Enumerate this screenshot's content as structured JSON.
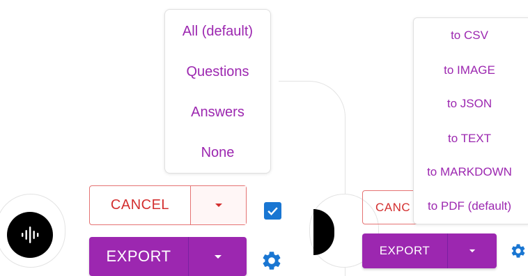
{
  "filter_menu": {
    "items": [
      "All (default)",
      "Questions",
      "Answers",
      "None"
    ]
  },
  "left_panel": {
    "cancel_label": "CANCEL",
    "export_label": "EXPORT",
    "checkbox_checked": true
  },
  "right_panel": {
    "cancel_label": "CANC",
    "export_label": "EXPORT"
  },
  "export_menu": {
    "items": [
      "to CSV",
      "to IMAGE",
      "to JSON",
      "to TEXT",
      "to MARKDOWN",
      "to PDF (default)"
    ]
  },
  "colors": {
    "primary": "#9c27b0",
    "error": "#d32f2f",
    "checkbox": "#1976d2"
  },
  "icons": {
    "mic": "audio-wave-icon",
    "dropdown": "caret-down-icon",
    "settings": "gear-icon",
    "check": "check-icon"
  }
}
